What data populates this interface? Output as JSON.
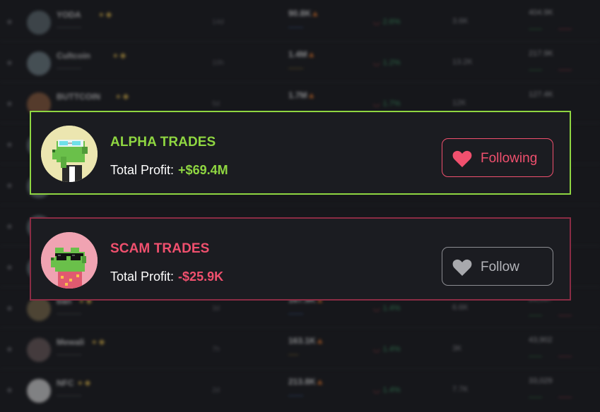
{
  "alpha_card": {
    "title": "ALPHA TRADES",
    "profit_label": "Total Profit:",
    "profit_value": "+$69.4M",
    "button_label": "Following",
    "accent_color": "#8fd641"
  },
  "scam_card": {
    "title": "SCAM TRADES",
    "profit_label": "Total Profit:",
    "profit_value": "-$25.9K",
    "button_label": "Follow",
    "accent_color": "#f0506e"
  },
  "background_rows": [
    {
      "name": "YODA",
      "vol": "90.8K",
      "age": "14d",
      "chg": "2.6%",
      "mcap": "3.6K",
      "tot": "404.9K"
    },
    {
      "name": "Cultcoin",
      "vol": "1.4M",
      "age": "10h",
      "chg": "1.2%",
      "mcap": "13.2K",
      "tot": "217.9K"
    },
    {
      "name": "BUTTCOIN",
      "vol": "1.7M",
      "age": "5d",
      "chg": "1.7%",
      "mcap": "12K",
      "tot": "127.4K"
    },
    {
      "name": "",
      "vol": "",
      "age": "",
      "chg": "",
      "mcap": "",
      "tot": ""
    },
    {
      "name": "",
      "vol": "",
      "age": "",
      "chg": "",
      "mcap": "",
      "tot": ""
    },
    {
      "name": "",
      "vol": "",
      "age": "",
      "chg": "",
      "mcap": "",
      "tot": ""
    },
    {
      "name": "",
      "vol": "",
      "age": "",
      "chg": "",
      "mcap": "",
      "tot": ""
    },
    {
      "name": "ban",
      "vol": "167.9K",
      "age": "3d",
      "chg": "1.4%",
      "mcap": "6.6K",
      "tot": "26,597"
    },
    {
      "name": "Mewali",
      "vol": "163.1K",
      "age": "7h",
      "chg": "1.4%",
      "mcap": "3K",
      "tot": "43,902"
    },
    {
      "name": "NFC",
      "vol": "213.8K",
      "age": "2d",
      "chg": "1.4%",
      "mcap": "7.7K",
      "tot": "33,029"
    }
  ]
}
